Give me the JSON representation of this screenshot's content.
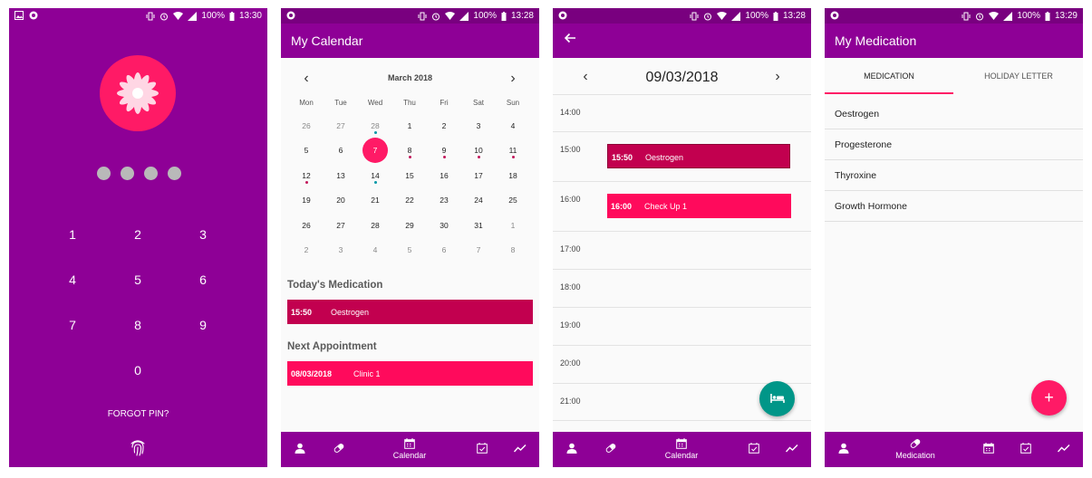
{
  "screens": {
    "lock": {
      "status_time": "13:30",
      "battery": "100%",
      "pin_digit_count": 4,
      "keys": [
        "1",
        "2",
        "3",
        "4",
        "5",
        "6",
        "7",
        "8",
        "9",
        "0"
      ],
      "forgot_label": "FORGOT PIN?"
    },
    "calendar": {
      "status_time": "13:28",
      "battery": "100%",
      "title": "My Calendar",
      "month_label": "March 2018",
      "weekdays": [
        "Mon",
        "Tue",
        "Wed",
        "Thu",
        "Fri",
        "Sat",
        "Sun"
      ],
      "weeks": [
        [
          "26",
          "27",
          "28",
          "1",
          "2",
          "3",
          "4"
        ],
        [
          "5",
          "6",
          "7",
          "8",
          "9",
          "10",
          "11"
        ],
        [
          "12",
          "13",
          "14",
          "15",
          "16",
          "17",
          "18"
        ],
        [
          "19",
          "20",
          "21",
          "22",
          "23",
          "24",
          "25"
        ],
        [
          "26",
          "27",
          "28",
          "29",
          "30",
          "31",
          "1"
        ],
        [
          "2",
          "3",
          "4",
          "5",
          "6",
          "7",
          "8"
        ]
      ],
      "selected_day": "7",
      "todays_medication_title": "Today's Medication",
      "todays_medication": {
        "time": "15:50",
        "name": "Oestrogen"
      },
      "next_appointment_title": "Next Appointment",
      "next_appointment": {
        "date": "08/03/2018",
        "name": "Clinic 1"
      }
    },
    "day": {
      "status_time": "13:28",
      "battery": "100%",
      "date_label": "09/03/2018",
      "hours": [
        "14:00",
        "15:00",
        "16:00",
        "17:00",
        "18:00",
        "19:00",
        "20:00",
        "21:00"
      ],
      "events": [
        {
          "time": "15:50",
          "label": "Oestrogen",
          "color": "#c2004f"
        },
        {
          "time": "16:00",
          "label": "Check Up 1",
          "color": "#ff0a5c"
        }
      ],
      "fab_icon": "hospital-bed-icon",
      "fab_color": "#009688"
    },
    "medication": {
      "status_time": "13:29",
      "battery": "100%",
      "title": "My Medication",
      "tabs": [
        "MEDICATION",
        "HOLIDAY LETTER"
      ],
      "active_tab": "MEDICATION",
      "items": [
        "Oestrogen",
        "Progesterone",
        "Thyroxine",
        "Growth Hormone"
      ],
      "fab_icon": "plus-icon",
      "fab_label": "+",
      "fab_color": "#ff1a66"
    }
  },
  "nav": {
    "calendar_label": "Calendar",
    "medication_label": "Medication"
  },
  "colors": {
    "primary": "#8e0096",
    "statusbar": "#79007f",
    "accent": "#ff1a66",
    "medication_bar": "#c2004f"
  }
}
